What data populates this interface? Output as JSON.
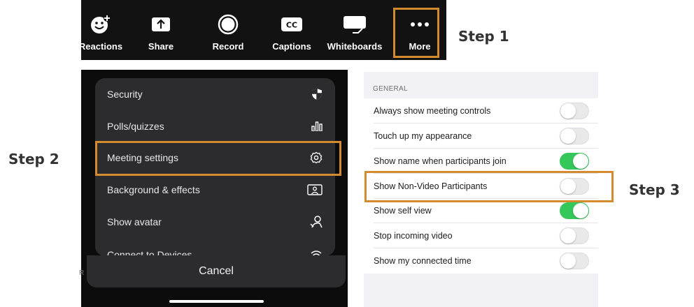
{
  "colors": {
    "highlight": "#d48a2e",
    "toggle_on": "#34c759",
    "dark_bg": "#121212",
    "menu_bg": "#2c2c2e"
  },
  "toolbar": {
    "buttons": [
      {
        "label": "Reactions",
        "icon": "smiley-plus-icon"
      },
      {
        "label": "Share",
        "icon": "share-up-arrow-icon"
      },
      {
        "label": "Record",
        "icon": "record-circle-icon"
      },
      {
        "label": "Captions",
        "icon": "cc-icon"
      },
      {
        "label": "Whiteboards",
        "icon": "whiteboard-icon"
      },
      {
        "label": "More",
        "icon": "ellipsis-icon"
      }
    ]
  },
  "steps": {
    "step1": "Step 1",
    "step2": "Step 2",
    "step3": "Step 3"
  },
  "menu": {
    "items": [
      {
        "label": "Security",
        "icon": "shield-icon"
      },
      {
        "label": "Polls/quizzes",
        "icon": "bar-chart-icon"
      },
      {
        "label": "Meeting settings",
        "icon": "gear-icon"
      },
      {
        "label": "Background & effects",
        "icon": "portrait-frame-icon"
      },
      {
        "label": "Show avatar",
        "icon": "avatar-icon"
      },
      {
        "label": "Connect to Devices",
        "icon": "wireless-icon"
      }
    ],
    "cancel": "Cancel",
    "edge_char": "R"
  },
  "settings": {
    "section": "GENERAL",
    "rows": [
      {
        "label": "Always show meeting controls",
        "on": false
      },
      {
        "label": "Touch up my appearance",
        "on": false
      },
      {
        "label": "Show name when participants join",
        "on": true
      },
      {
        "label": "Show Non-Video Participants",
        "on": false
      },
      {
        "label": "Show self view",
        "on": true
      },
      {
        "label": "Stop incoming video",
        "on": false
      },
      {
        "label": "Show my connected time",
        "on": false
      }
    ]
  }
}
